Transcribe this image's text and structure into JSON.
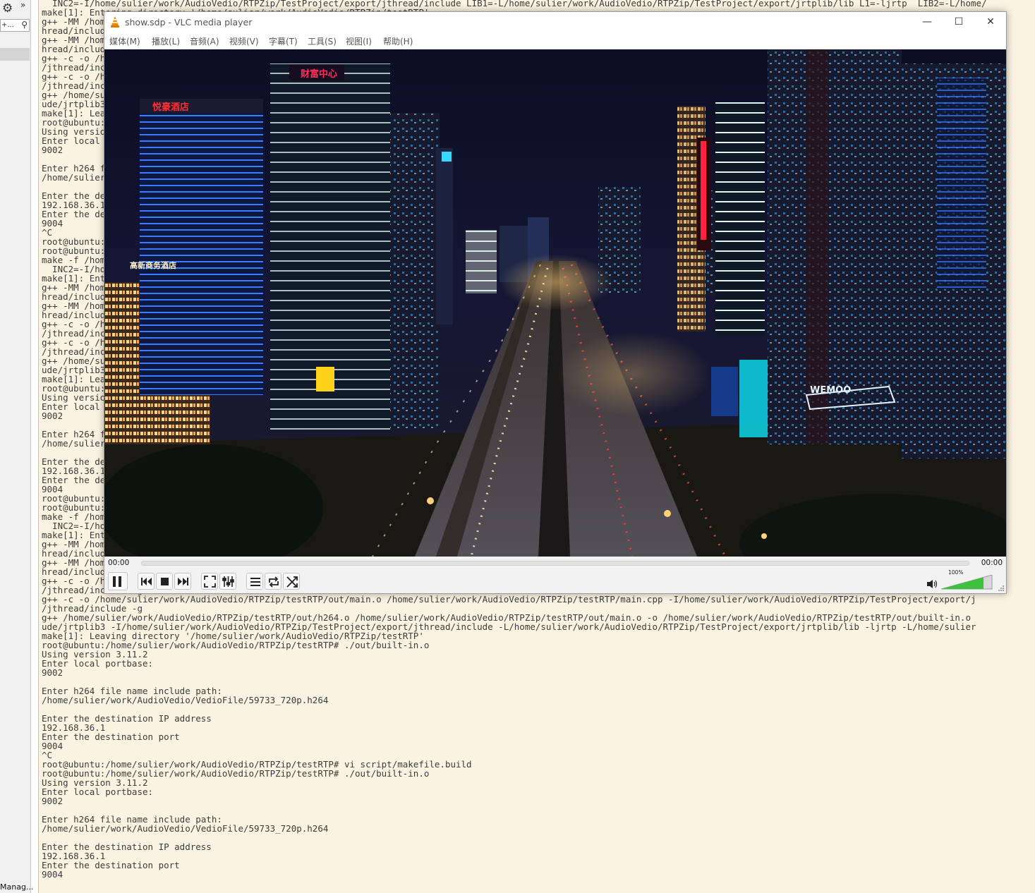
{
  "left_panel": {
    "settings_icon": "gear-icon",
    "overflow_icon": "chevron-right-double-icon",
    "search_text": "+...",
    "search_icon": "search-icon",
    "bottom_label": "Manag..."
  },
  "terminal": {
    "lines": [
      "  INC2=-I/home/sulier/work/AudioVedio/RTPZip/TestProject/export/jthread/include LIB1=-L/home/sulier/work/AudioVedio/RTPZip/TestProject/export/jrtplib/lib L1=-ljrtp  LIB2=-L/home/",
      "make[1]: Entering directory '/home/sulier/work/AudioVedio/RTPZip/testRTP'",
      "g++ -MM /home/sulier/work/AudioVedio/RTPZip/testRTP/main.cpp -I/home/sulier/work/AudioVedio/RTPZip/TestProject/export/jrtp",
      "hread/include",
      "g++ -MM /home/sulier/work/AudioVedio/RTPZip/testRTP/h264.cpp -I/home/sulier/work/AudioVedio/RTPZip/TestProject/export/jrtp",
      "hread/include",
      "g++ -c -o /home/sulier/work/AudioVedio/RTPZip/testRTP/out/h264.o /home/sulier/work/AudioVedio/RTPZip/testRTP/h264.cpp -I/home/sulier/work/AudioVedio/RTPZip/TestProject/export/j",
      "/jthread/include -g",
      "g++ -c -o /home/sulier/work/AudioVedio/RTPZip/testRTP/out/main.o /home/sulier/work/AudioVedio/RTPZip/testRTP/main.cpp -I/home/sulier/work/AudioVedio/RTPZip/TestProject/export/j",
      "/jthread/include -g",
      "g++ /home/sulier/work/AudioVedio/RTPZip/testRTP/out/h264.o /home/sulier/work/AudioVedio/RTPZip/testRTP/out/main.o -o /home/sulier/work/AudioVedio/RTPZip/testRTP/out/built-in.o",
      "ude/jrtplib3 -I/home/sulier/work/AudioVedio/RTPZip/TestProject/export/jthread/include -L/home/sulier/work/AudioVedio/RTPZip/TestProject/export/jrtplib/lib -ljrtp -L/home/sulier",
      "make[1]: Leaving directory '/home/sulier/work/AudioVedio/RTPZip/testRTP'",
      "root@ubuntu:/home/sulier/work/AudioVedio/RTPZip/testRTP# ./out/built-in.o",
      "Using version 3.11.2",
      "Enter local portbase:",
      "9002",
      "",
      "Enter h264 file name include path:",
      "/home/sulier/work/AudioVedio/VedioFile/59733_720p.h264",
      "",
      "Enter the destination IP address",
      "192.168.36.1",
      "Enter the destination port",
      "9004",
      "^C",
      "root@ubuntu:/home/sulier/work/AudioVedio/RTPZip/testRTP# vi script/makefile.build",
      "root@ubuntu:/home/sulier/work/AudioVedio/RTPZip/testRTP# make -f /home/sulier/work/AudioVedio/RTPZip/testRTP/script/makefile.build all INC1=-",
      "make -f /home/sulier/work/AudioVedio/RTPZip/testRTP/script/makefile.build all INC1=-I/home/sulier/work/AudioVedio/RTPZip/TestProject/export/jrtplib/include/jrtplib3 INC1=-/home",
      "  INC2=-I/home/sulier/work/AudioVedio/RTPZip/TestProject/export/jthread/include LIB1=-L/home/sulier/work/AudioVedio/RTPZip/TestProject/export/jrtplib/lib L1=-ljrtp  LIB2=-L/home",
      "make[1]: Entering directory '/home/sulier/work/AudioVedio/RTPZip/testRTP'",
      "g++ -MM /home/sulier/work/AudioVedio/RTPZip/testRTP/main.cpp -I/home/sulier/work/AudioVedio/RTPZip/TestProject/export/jrtp",
      "hread/include",
      "g++ -MM /home/sulier/work/AudioVedio/RTPZip/testRTP/h264.cpp -I/home/sulier/work/AudioVedio/RTPZip/TestProject/export/jrtp",
      "hread/include",
      "g++ -c -o /home/sulier/work/AudioVedio/RTPZip/testRTP/out/h264.o /home/sulier/work/AudioVedio/RTPZip/testRTP/h264.cpp -I/home/sulier/work/AudioVedio/RTPZip/TestProject/export/j",
      "/jthread/include -g",
      "g++ -c -o /home/sulier/work/AudioVedio/RTPZip/testRTP/out/main.o /home/sulier/work/AudioVedio/RTPZip/testRTP/main.cpp -I/home/sulier/work/AudioVedio/RTPZip/TestProject/export/j",
      "/jthread/include -g",
      "g++ /home/sulier/work/AudioVedio/RTPZip/testRTP/out/h264.o /home/sulier/work/AudioVedio/RTPZip/testRTP/out/main.o -o /home/sulier/work/AudioVedio/RTPZip/testRTP/out/built-in.o",
      "ude/jrtplib3 -I/home/sulier/work/AudioVedio/RTPZip/TestProject/export/jthread/include -L/home/sulier/work/AudioVedio/RTPZip/TestProject/export/jrtplib/lib -ljrtp -L/home/sulier",
      "make[1]: Leaving directory '/home/sulier/work/AudioVedio/RTPZip/testRTP'",
      "root@ubuntu:/home/sulier/work/AudioVedio/RTPZip/testRTP# ./out/built-in.o",
      "Using version 3.11.2",
      "Enter local portbase:",
      "9002",
      "",
      "Enter h264 file name include path:",
      "/home/sulier/work/AudioVedio/VedioFile/59733_720p.h264",
      "",
      "Enter the destination IP address",
      "192.168.36.1",
      "Enter the destination port",
      "9004",
      "root@ubuntu:/home/sulier/work/AudioVedio/RTPZip/testRTP# vi script/makefile.build",
      "root@ubuntu:/home/sulier/work/AudioVedio/RTPZip/testRTP# make -f /home/sulier/work/AudioVedio/RTPZip/testRTP/script/makefile.build all INC1=-",
      "make -f /home/sulier/work/AudioVedio/RTPZip/testRTP/script/makefile.build all INC1=-I/home/sulier/work/AudioVedio/RTPZip/TestProject/export/jrtplib/include/jrtplib3 INC1=-/home",
      "  INC2=-I/home/sulier/work/AudioVedio/RTPZip/TestProject/export/jthread/include LIB1=-L/home/sulier/work/AudioVedio/RTPZip/TestProject/export/jrtplib/lib L1=-ljrtp  LIB2=-L/home",
      "make[1]: Entering directory '/home/sulier/work/AudioVedio/RTPZip/testRTP'",
      "g++ -MM /home/sulier/work/AudioVedio/RTPZip/testRTP/main.cpp -I/home/sulier/work/AudioVedio/RTPZip/TestProject/export/jrtp",
      "hread/include",
      "g++ -MM /home/sulier/work/AudioVedio/RTPZip/testRTP/h264.cpp -I/home/sulier/work/AudioVedio/RTPZip/TestProject/export/jrtp",
      "hread/include",
      "g++ -c -o /home/sulier/work/AudioVedio/RTPZip/testRTP/out/h264.o /home/sulier/work/AudioVedio/RTPZip/testRTP/h264.cpp -I/home/sulier/work/AudioVedio/RTPZip/TestProject/export/j",
      "/jthread/include -g",
      "g++ -c -o /home/sulier/work/AudioVedio/RTPZip/testRTP/out/main.o /home/sulier/work/AudioVedio/RTPZip/testRTP/main.cpp -I/home/sulier/work/AudioVedio/RTPZip/TestProject/export/j",
      "/jthread/include -g",
      "g++ /home/sulier/work/AudioVedio/RTPZip/testRTP/out/h264.o /home/sulier/work/AudioVedio/RTPZip/testRTP/out/main.o -o /home/sulier/work/AudioVedio/RTPZip/testRTP/out/built-in.o",
      "ude/jrtplib3 -I/home/sulier/work/AudioVedio/RTPZip/TestProject/export/jthread/include -L/home/sulier/work/AudioVedio/RTPZip/TestProject/export/jrtplib/lib -ljrtp -L/home/sulier",
      "make[1]: Leaving directory '/home/sulier/work/AudioVedio/RTPZip/testRTP'",
      "root@ubuntu:/home/sulier/work/AudioVedio/RTPZip/testRTP# ./out/built-in.o",
      "Using version 3.11.2",
      "Enter local portbase:",
      "9002",
      "",
      "Enter h264 file name include path:",
      "/home/sulier/work/AudioVedio/VedioFile/59733_720p.h264",
      "",
      "Enter the destination IP address",
      "192.168.36.1",
      "Enter the destination port",
      "9004",
      "^C",
      "root@ubuntu:/home/sulier/work/AudioVedio/RTPZip/testRTP# vi script/makefile.build",
      "root@ubuntu:/home/sulier/work/AudioVedio/RTPZip/testRTP# ./out/built-in.o",
      "Using version 3.11.2",
      "Enter local portbase:",
      "9002",
      "",
      "Enter h264 file name include path:",
      "/home/sulier/work/AudioVedio/VedioFile/59733_720p.h264",
      "",
      "Enter the destination IP address",
      "192.168.36.1",
      "Enter the destination port",
      "9004"
    ]
  },
  "vlc": {
    "title": "show.sdp - VLC media player",
    "app_icon": "vlc-cone-icon",
    "window_buttons": {
      "minimize": "—",
      "maximize": "☐",
      "close": "✕"
    },
    "menu": [
      "媒体(M)",
      "播放(L)",
      "音频(A)",
      "视频(V)",
      "字幕(T)",
      "工具(S)",
      "视图(I)",
      "帮助(H)"
    ],
    "video": {
      "content": "night-city-aerial-video-frame",
      "signs": [
        "财富中心",
        "悦豪酒店",
        "高新商务酒店",
        "WEMOO"
      ]
    },
    "time_elapsed": "00:00",
    "time_total": "00:00",
    "seek_progress": 0,
    "volume_label": "100%",
    "volume_level": 1.0,
    "accent_color": "#3cc23c",
    "buttons": [
      {
        "name": "pause-button",
        "icon": "pause-icon"
      },
      {
        "name": "previous-button",
        "icon": "skip-previous-icon"
      },
      {
        "name": "stop-button",
        "icon": "stop-icon"
      },
      {
        "name": "next-button",
        "icon": "skip-next-icon"
      },
      {
        "name": "fullscreen-button",
        "icon": "fullscreen-icon"
      },
      {
        "name": "extended-settings-button",
        "icon": "equalizer-icon"
      },
      {
        "name": "playlist-button",
        "icon": "playlist-icon"
      },
      {
        "name": "loop-button",
        "icon": "loop-icon"
      },
      {
        "name": "random-button",
        "icon": "shuffle-icon"
      }
    ]
  }
}
